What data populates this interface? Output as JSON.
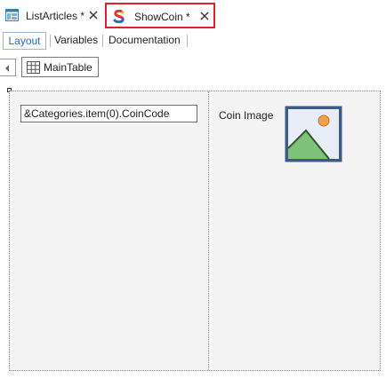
{
  "document_tabs": [
    {
      "label": "ListArticles",
      "modified": "*",
      "icon": "web-panel-icon",
      "active": false
    },
    {
      "label": "ShowCoin",
      "modified": "*",
      "icon": "sd-panel-icon",
      "active": true
    }
  ],
  "view_tabs": {
    "layout": "Layout",
    "variables": "Variables",
    "documentation": "Documentation",
    "selected": "Layout"
  },
  "breadcrumb": {
    "item": "MainTable",
    "icon": "table-grid-icon"
  },
  "canvas": {
    "attribute_field": "&Categories.item(0).CoinCode",
    "image_label": "Coin Image",
    "image_icon": "image-placeholder-icon"
  },
  "colors": {
    "active_tab_border": "#e0202e",
    "selected_view_tab": "#2d6db5",
    "canvas_bg": "#f4f4f4"
  }
}
